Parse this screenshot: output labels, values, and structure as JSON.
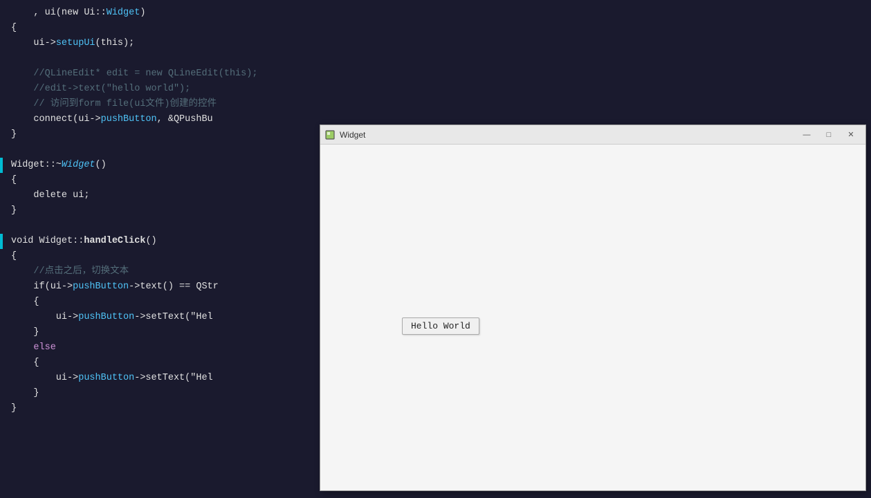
{
  "editor": {
    "background": "#1a1a2e",
    "lines": [
      {
        "marker": false,
        "content": [
          {
            "text": "    , ui(new Ui::",
            "color": "c-white"
          },
          {
            "text": "Widget",
            "color": "c-cyan"
          },
          {
            "text": ")",
            "color": "c-white"
          }
        ]
      },
      {
        "marker": false,
        "content": [
          {
            "text": "{",
            "color": "c-white"
          }
        ]
      },
      {
        "marker": false,
        "content": [
          {
            "text": "    ui->",
            "color": "c-white"
          },
          {
            "text": "setupUi",
            "color": "c-cyan"
          },
          {
            "text": "(this);",
            "color": "c-white"
          }
        ]
      },
      {
        "marker": false,
        "content": [
          {
            "text": "",
            "color": "c-white"
          }
        ]
      },
      {
        "marker": false,
        "content": [
          {
            "text": "    //QLineEdit* edit = new QLineEdit(this);",
            "color": "c-comment"
          }
        ]
      },
      {
        "marker": false,
        "content": [
          {
            "text": "    //edit->text(\"hello world\");",
            "color": "c-comment"
          }
        ]
      },
      {
        "marker": false,
        "content": [
          {
            "text": "    // 访问到form file(ui文件)创建的控件",
            "color": "c-comment"
          }
        ]
      },
      {
        "marker": false,
        "content": [
          {
            "text": "    connect(ui->",
            "color": "c-white"
          },
          {
            "text": "pushButton",
            "color": "c-cyan"
          },
          {
            "text": ", &QPushBu",
            "color": "c-white"
          }
        ]
      },
      {
        "marker": false,
        "content": [
          {
            "text": "}",
            "color": "c-white"
          }
        ]
      },
      {
        "marker": false,
        "content": [
          {
            "text": "",
            "color": "c-white"
          }
        ]
      },
      {
        "marker": true,
        "content": [
          {
            "text": "Widget::~",
            "color": "c-white"
          },
          {
            "text": "Widget",
            "color": "c-italic c-cyan"
          },
          {
            "text": "()",
            "color": "c-white"
          }
        ]
      },
      {
        "marker": false,
        "content": [
          {
            "text": "{",
            "color": "c-white"
          }
        ]
      },
      {
        "marker": false,
        "content": [
          {
            "text": "    delete ui;",
            "color": "c-white"
          }
        ]
      },
      {
        "marker": false,
        "content": [
          {
            "text": "}",
            "color": "c-white"
          }
        ]
      },
      {
        "marker": false,
        "content": [
          {
            "text": "",
            "color": "c-white"
          }
        ]
      },
      {
        "marker": true,
        "content": [
          {
            "text": "void Widget::",
            "color": "c-white"
          },
          {
            "text": "handleClick",
            "color": "c-bold c-white"
          },
          {
            "text": "()",
            "color": "c-white"
          }
        ]
      },
      {
        "marker": false,
        "content": [
          {
            "text": "{",
            "color": "c-white"
          }
        ]
      },
      {
        "marker": false,
        "content": [
          {
            "text": "    //点击之后，切换文本",
            "color": "c-comment"
          }
        ]
      },
      {
        "marker": false,
        "content": [
          {
            "text": "    if(ui->",
            "color": "c-white"
          },
          {
            "text": "pushButton",
            "color": "c-cyan"
          },
          {
            "text": "->text() == QStr",
            "color": "c-white"
          }
        ]
      },
      {
        "marker": false,
        "content": [
          {
            "text": "    {",
            "color": "c-white"
          }
        ]
      },
      {
        "marker": false,
        "content": [
          {
            "text": "        ui->",
            "color": "c-white"
          },
          {
            "text": "pushButton",
            "color": "c-cyan"
          },
          {
            "text": "->setText(\"Hel",
            "color": "c-white"
          }
        ]
      },
      {
        "marker": false,
        "content": [
          {
            "text": "    }",
            "color": "c-white"
          }
        ]
      },
      {
        "marker": false,
        "content": [
          {
            "text": "    else",
            "color": "c-purple"
          }
        ]
      },
      {
        "marker": false,
        "content": [
          {
            "text": "    {",
            "color": "c-white"
          }
        ]
      },
      {
        "marker": false,
        "content": [
          {
            "text": "        ui->",
            "color": "c-white"
          },
          {
            "text": "pushButton",
            "color": "c-cyan"
          },
          {
            "text": "->setText(\"Hel",
            "color": "c-white"
          }
        ]
      },
      {
        "marker": false,
        "content": [
          {
            "text": "    }",
            "color": "c-white"
          }
        ]
      },
      {
        "marker": false,
        "content": [
          {
            "text": "}",
            "color": "c-white"
          }
        ]
      }
    ]
  },
  "qt_window": {
    "title": "Widget",
    "icon": "widget-icon",
    "controls": {
      "minimize_label": "—",
      "maximize_label": "□",
      "close_label": "✕"
    },
    "button_label": "Hello World"
  }
}
